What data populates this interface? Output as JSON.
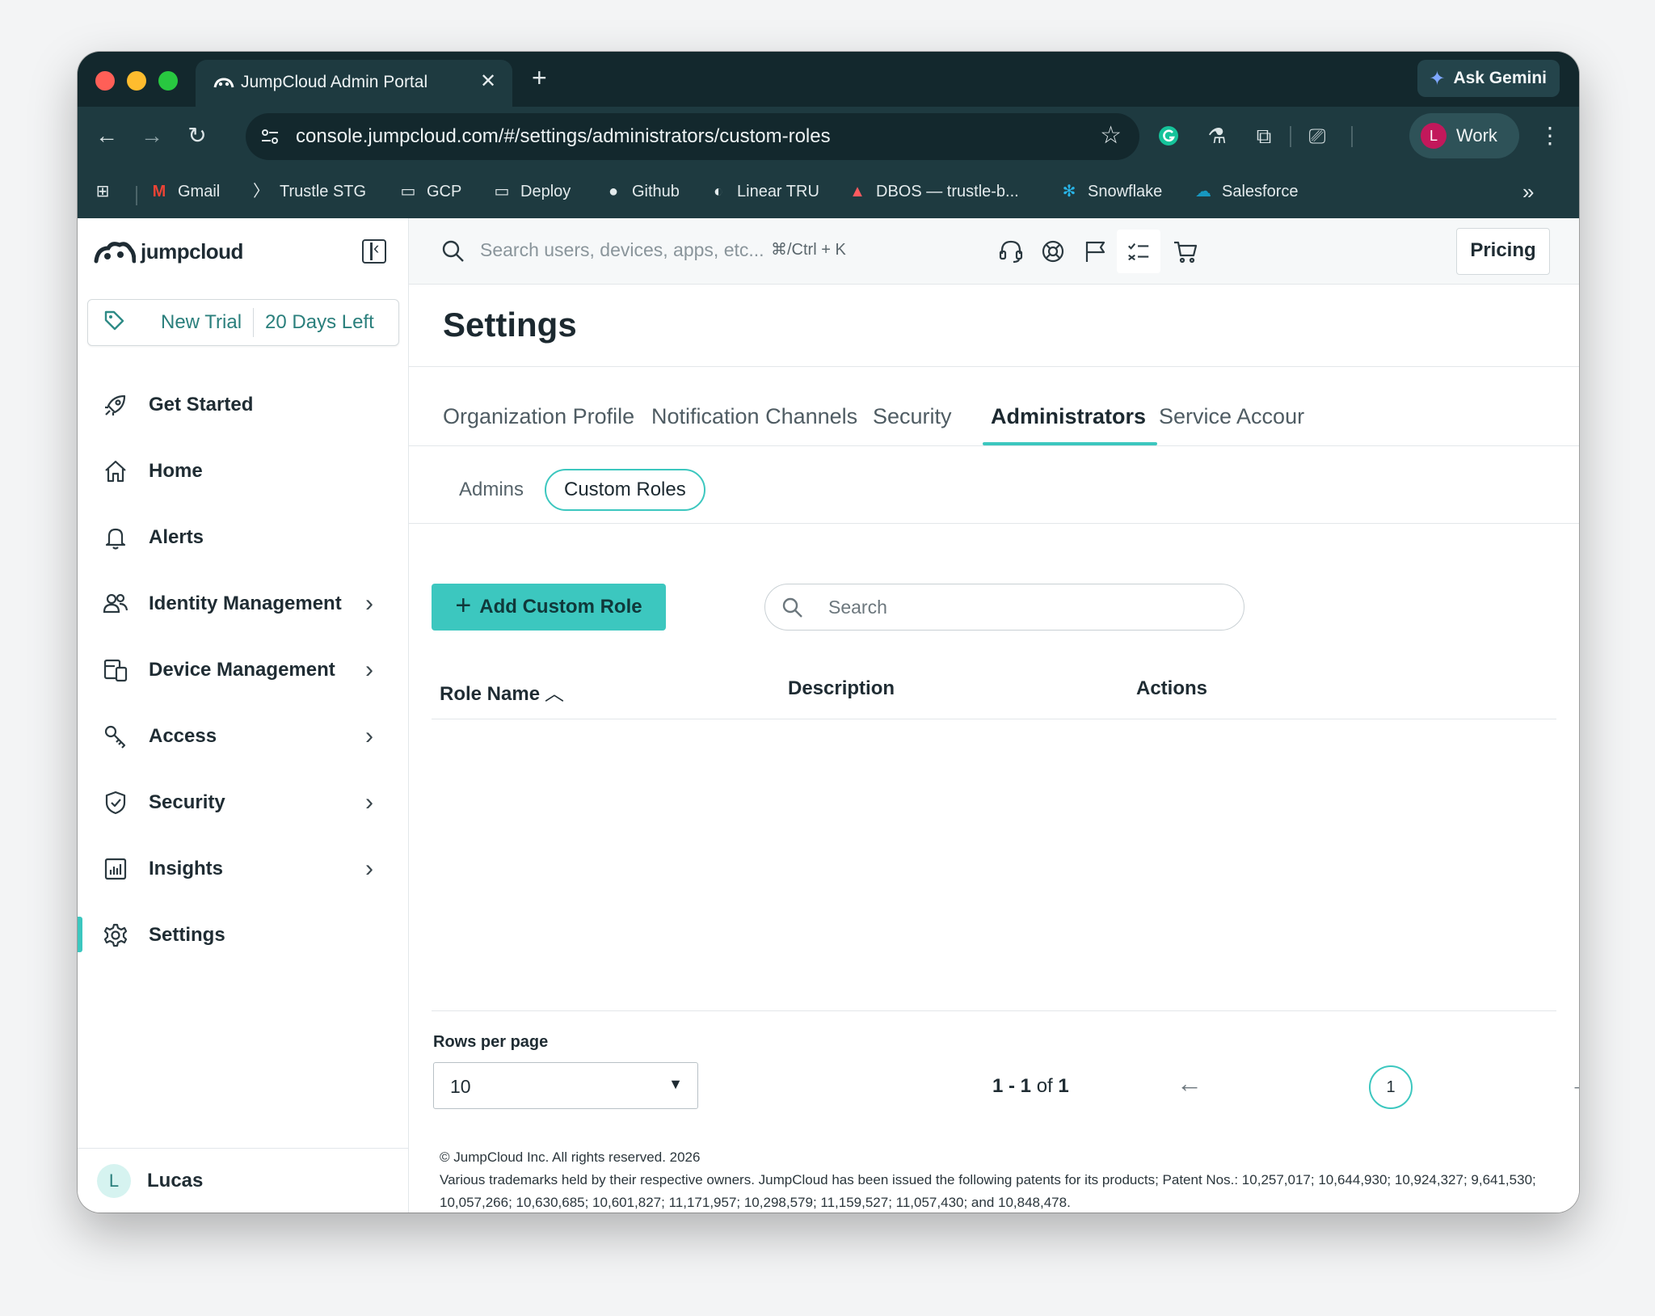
{
  "browser": {
    "tab_title": "JumpCloud Admin Portal",
    "tab_close": "✕",
    "new_tab": "+",
    "gemini_label": "Ask Gemini",
    "url": "console.jumpcloud.com/#/settings/administrators/custom-roles",
    "profile_initial": "L",
    "profile_name": "Work",
    "bookmarks": [
      {
        "label": "Gmail",
        "icon": "gmail-icon"
      },
      {
        "label": "Trustle STG",
        "icon": "trustle-icon"
      },
      {
        "label": "GCP",
        "icon": "folder-icon"
      },
      {
        "label": "Deploy",
        "icon": "folder-icon"
      },
      {
        "label": "Github",
        "icon": "github-icon"
      },
      {
        "label": "Linear TRU",
        "icon": "linear-icon"
      },
      {
        "label": "DBOS — trustle-b...",
        "icon": "dbos-icon"
      },
      {
        "label": "Snowflake",
        "icon": "snowflake-icon"
      },
      {
        "label": "Salesforce",
        "icon": "salesforce-icon"
      }
    ]
  },
  "sidebar": {
    "logo_text": "jumpcloud",
    "trial_label": "New Trial",
    "trial_days": "20 Days Left",
    "items": [
      {
        "label": "Get Started",
        "icon": "rocket-icon",
        "chevron": false
      },
      {
        "label": "Home",
        "icon": "home-icon",
        "chevron": false
      },
      {
        "label": "Alerts",
        "icon": "bell-icon",
        "chevron": false
      },
      {
        "label": "Identity Management",
        "icon": "users-icon",
        "chevron": true
      },
      {
        "label": "Device Management",
        "icon": "devices-icon",
        "chevron": true
      },
      {
        "label": "Access",
        "icon": "key-icon",
        "chevron": true
      },
      {
        "label": "Security",
        "icon": "shield-icon",
        "chevron": true
      },
      {
        "label": "Insights",
        "icon": "chart-icon",
        "chevron": true
      },
      {
        "label": "Settings",
        "icon": "gear-icon",
        "chevron": false,
        "active": true
      }
    ],
    "user_initial": "L",
    "user_name": "Lucas"
  },
  "topbar": {
    "search_placeholder": "Search users, devices, apps, etc...",
    "shortcut": "⌘/Ctrl + K",
    "pricing_label": "Pricing"
  },
  "main": {
    "title": "Settings",
    "tabs": [
      {
        "label": "Organization Profile"
      },
      {
        "label": "Notification Channels"
      },
      {
        "label": "Security"
      },
      {
        "label": "Administrators",
        "active": true
      },
      {
        "label": "Service Accour"
      }
    ],
    "subtabs": [
      {
        "label": "Admins"
      },
      {
        "label": "Custom Roles",
        "active": true
      }
    ],
    "add_button": "Add Custom Role",
    "search_placeholder": "Search",
    "columns": {
      "role_name": "Role Name",
      "description": "Description",
      "actions": "Actions"
    },
    "rows_per_page_label": "Rows per page",
    "rows_per_page_value": "10",
    "pagination": {
      "range": "1 - 1",
      "of_word": "of",
      "total": "1",
      "current_page": "1"
    },
    "footer": {
      "copyright": "© JumpCloud Inc. All rights reserved. 2026",
      "patents": "Various trademarks held by their respective owners. JumpCloud has been issued the following patents for its products; Patent Nos.: 10,257,017; 10,644,930; 10,924,327; 9,641,530; 10,057,266; 10,630,685; 10,601,827; 11,171,957; 10,298,579; 11,159,527; 11,057,430; and 10,848,478."
    }
  },
  "colors": {
    "accent": "#3cc7bf",
    "chrome_dark": "#13282d",
    "chrome": "#1e3a40"
  }
}
